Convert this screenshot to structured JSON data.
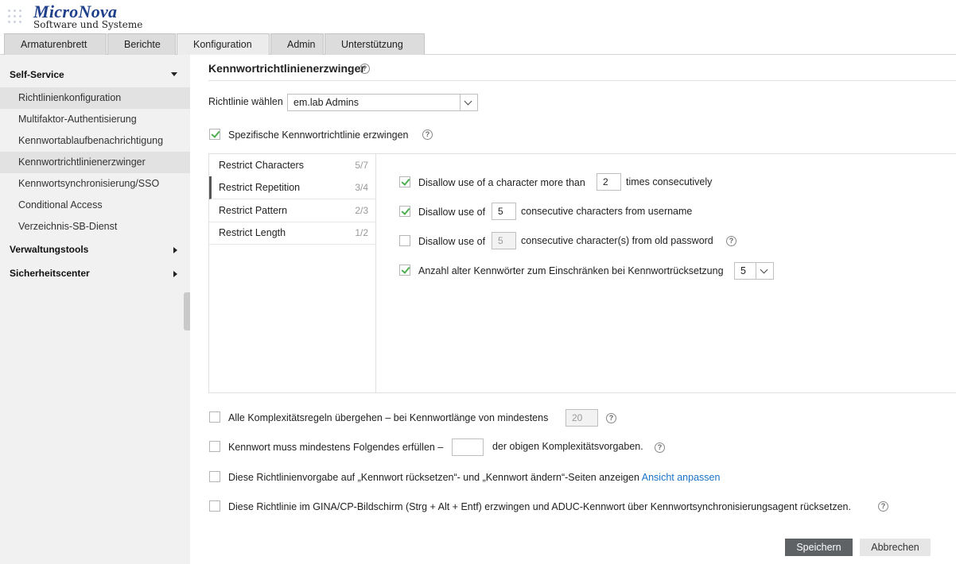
{
  "logo": {
    "name": "MicroNova",
    "subtitle": "Software und Systeme"
  },
  "tabs": [
    {
      "label": "Armaturenbrett"
    },
    {
      "label": "Berichte"
    },
    {
      "label": "Konfiguration"
    },
    {
      "label": "Admin"
    },
    {
      "label": "Unterstützung"
    }
  ],
  "sidebar": {
    "self_service": "Self-Service",
    "items": [
      {
        "label": "Richtlinienkonfiguration"
      },
      {
        "label": "Multifaktor-Authentisierung"
      },
      {
        "label": "Kennwortablaufbenachrichtigung"
      },
      {
        "label": "Kennwortrichtlinienerzwinger"
      },
      {
        "label": "Kennwortsynchronisierung/SSO"
      },
      {
        "label": "Conditional Access"
      },
      {
        "label": "Verzeichnis-SB-Dienst"
      }
    ],
    "verwaltungstools": "Verwaltungstools",
    "sicherheitscenter": "Sicherheitscenter"
  },
  "main": {
    "title": "Kennwortrichtlinienerzwinger",
    "policy_label": "Richtlinie wählen",
    "policy_value": "em.lab Admins",
    "enforce_label": "Spezifische Kennwortrichtlinie erzwingen",
    "vtabs": [
      {
        "label": "Restrict Characters",
        "count": "5/7"
      },
      {
        "label": "Restrict Repetition",
        "count": "3/4"
      },
      {
        "label": "Restrict Pattern",
        "count": "2/3"
      },
      {
        "label": "Restrict Length",
        "count": "1/2"
      }
    ],
    "repetition": {
      "r1_pre": "Disallow use of a character more than",
      "r1_value": "2",
      "r1_post": "times consecutively",
      "r2_pre": "Disallow use of",
      "r2_value": "5",
      "r2_post": "consecutive characters from username",
      "r3_pre": "Disallow use of",
      "r3_value": "5",
      "r3_post": "consecutive character(s) from old password",
      "r4_label": "Anzahl alter Kennwörter zum Einschränken bei Kennwortrücksetzung",
      "r4_value": "5"
    },
    "bottom": {
      "b1_label": "Alle Komplexitätsregeln übergehen – bei Kennwortlänge von mindestens",
      "b1_value": "20",
      "b2_pre": "Kennwort muss mindestens Folgendes erfüllen –",
      "b2_post": "der obigen Komplexitätsvorgaben.",
      "b3_label": "Diese Richtlinienvorgabe auf „Kennwort rücksetzen“- und „Kennwort ändern“-Seiten anzeigen",
      "b3_link": "Ansicht anpassen",
      "b4_label": "Diese Richtlinie im GINA/CP-Bildschirm (Strg + Alt + Entf) erzwingen und ADUC-Kennwort über Kennwortsynchronisierungsagent rücksetzen."
    },
    "save": "Speichern",
    "cancel": "Abbrechen",
    "help_glyph": "?"
  },
  "colors": {
    "accent_link": "#1a73c8",
    "check": "#4caf50",
    "brand": "#1e3f8a",
    "save_button": "#5f6265"
  }
}
